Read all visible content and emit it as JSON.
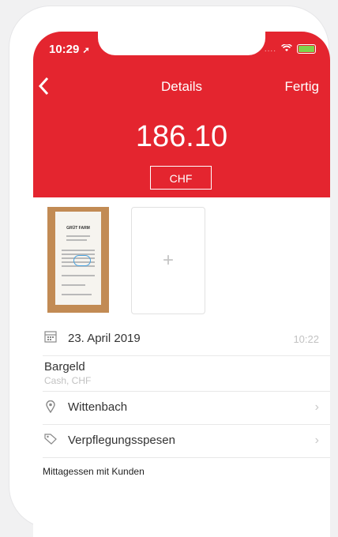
{
  "status": {
    "time": "10:29",
    "location_arrow": "location-arrow-icon"
  },
  "nav": {
    "title": "Details",
    "done_label": "Fertig",
    "back_icon": "chevron-left-icon"
  },
  "amount": {
    "value": "186.10",
    "currency": "CHF"
  },
  "attachments": {
    "receipt_title": "GRÜT FARM",
    "add_symbol": "+"
  },
  "date_row": {
    "date": "23. April 2019",
    "time": "10:22"
  },
  "payment_row": {
    "method": "Bargeld",
    "details": "Cash, CHF"
  },
  "location_row": {
    "label": "Wittenbach"
  },
  "category_row": {
    "label": "Verpflegungsspesen"
  },
  "notes": {
    "text": "Mittagessen mit Kunden"
  },
  "colors": {
    "accent": "#e4252f",
    "chevron": "#c8c8c8",
    "subtle_text": "#c2c2c2"
  }
}
